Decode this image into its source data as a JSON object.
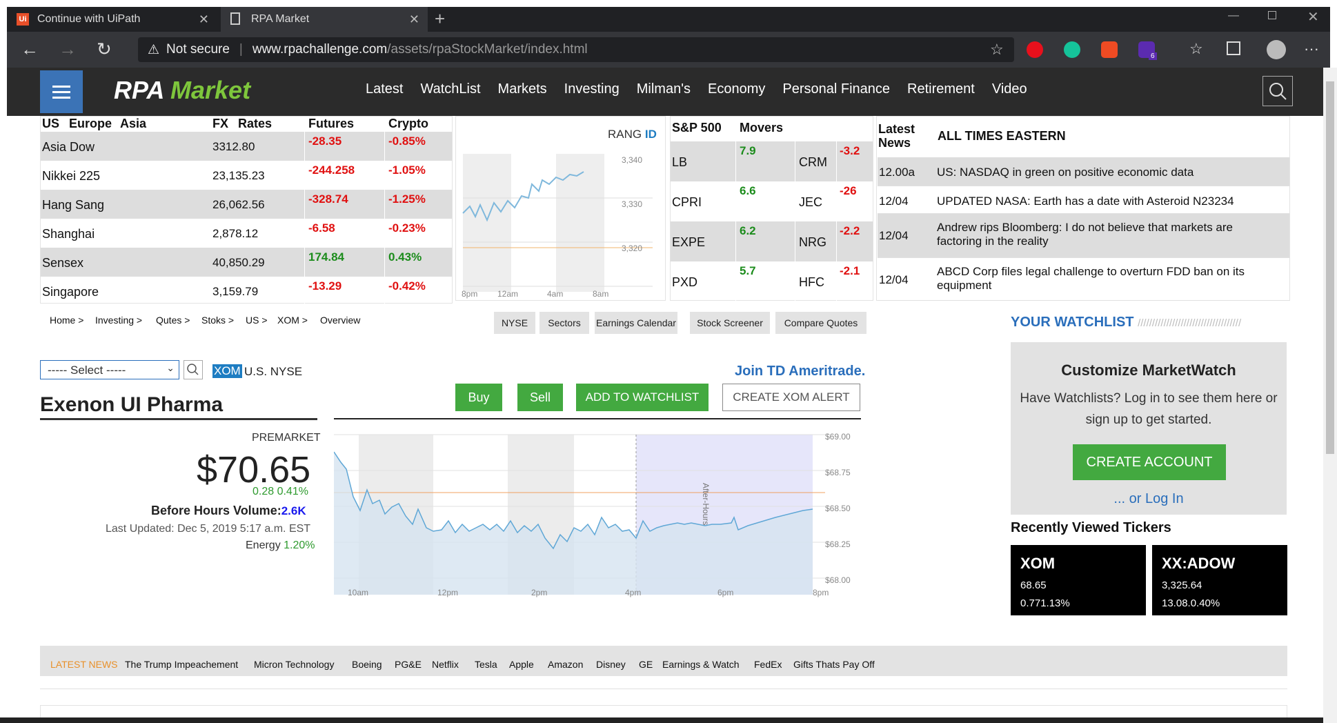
{
  "browser": {
    "tabs": [
      {
        "label": "Continue with UiPath"
      },
      {
        "label": "RPA Market"
      }
    ],
    "security": "Not secure",
    "url_host": "www.rpachallenge.com",
    "url_path": "/assets/rpaStockMarket/index.html",
    "ext_badge": "6",
    "ellipsis": "···"
  },
  "site": {
    "brand_a": "RPA",
    "brand_b": "Market",
    "nav": [
      "Latest",
      "WatchList",
      "Markets",
      "Investing",
      "Milman's",
      "Economy",
      "Personal Finance",
      "Retirement",
      "Video"
    ]
  },
  "markets": {
    "headers": [
      "US",
      "Europe",
      "Asia",
      "FX",
      "Rates",
      "Futures",
      "Crypto"
    ],
    "rows": [
      {
        "name": "Asia Dow",
        "fx": "3312.80",
        "fut": "-28.35",
        "cry": "-0.85%"
      },
      {
        "name": "Nikkei 225",
        "fx": "23,135.23",
        "fut": "-244.258",
        "cry": "-1.05%"
      },
      {
        "name": "Hang Sang",
        "fx": "26,062.56",
        "fut": "-328.74",
        "cry": "-1.25%"
      },
      {
        "name": "Shanghai",
        "fx": "2,878.12",
        "fut": "-6.58",
        "cry": "-0.23%"
      },
      {
        "name": "Sensex",
        "fx": "40,850.29",
        "fut": "174.84",
        "cry": "0.43%"
      },
      {
        "name": "Singapore",
        "fx": "3,159.79",
        "fut": "-13.29",
        "cry": "-0.42%"
      }
    ]
  },
  "mini_chart": {
    "label_a": "RANG",
    "label_b": "ID",
    "y_ticks": [
      "3,340",
      "3,330",
      "3,320"
    ],
    "x_ticks": [
      "8pm",
      "12am",
      "4am",
      "8am"
    ]
  },
  "sp500": {
    "h1": "S&P 500",
    "h2": "Movers",
    "rows": [
      {
        "l": "LB",
        "lv": "7.9",
        "r": "CRM",
        "rv": "-3.2"
      },
      {
        "l": "CPRI",
        "lv": "6.6",
        "r": "JEC",
        "rv": "-26"
      },
      {
        "l": "EXPE",
        "lv": "6.2",
        "r": "NRG",
        "rv": "-2.2"
      },
      {
        "l": "PXD",
        "lv": "5.7",
        "r": "HFC",
        "rv": "-2.1"
      }
    ]
  },
  "news": {
    "h1": "Latest News",
    "h2": "ALL TIMES EASTERN",
    "rows": [
      {
        "t": "12.00a",
        "h": "US: NASDAQ in green on positive economic data"
      },
      {
        "t": "12/04",
        "h": "UPDATED NASA: Earth has a date with Asteroid N23234"
      },
      {
        "t": "12/04",
        "h": "Andrew rips Bloomberg: I do not believe that markets are factoring in the reality"
      },
      {
        "t": "12/04",
        "h": "ABCD Corp files legal challenge to overturn FDD ban on its equipment"
      }
    ]
  },
  "breadcrumb": [
    "Home >",
    "Investing >",
    "Qutes >",
    "Stoks >",
    "US >",
    "XOM >",
    "Overview"
  ],
  "quick_links": [
    "NYSE",
    "Sectors",
    "Earnings Calendar",
    "Stock Screener",
    "Compare Quotes"
  ],
  "stock": {
    "select": "----- Select -----",
    "ticker": "XOM",
    "exchange": "U.S. NYSE",
    "name": "Exenon UI Pharma",
    "premarket": "PREMARKET",
    "price": "$70.65",
    "change": "0.28 0.41%",
    "volume_label": "Before Hours Volume:",
    "volume": "2.6K",
    "updated": "Last Updated: Dec 5, 2019 5:17 a.m. EST",
    "sector": "Energy",
    "sector_change": "1.20%",
    "join": "Join TD Ameritrade.",
    "buy": "Buy",
    "sell": "Sell",
    "watch": "ADD TO WATCHLIST",
    "alert": "CREATE XOM ALERT"
  },
  "main_chart": {
    "y_ticks": [
      "$69.00",
      "$68.75",
      "$68.50",
      "$68.25",
      "$68.00"
    ],
    "x_ticks": [
      "10am",
      "12pm",
      "2pm",
      "4pm",
      "6pm",
      "8pm"
    ],
    "after": "After-Hours"
  },
  "watchlist": {
    "title": "YOUR WATCHLIST",
    "heading": "Customize MarketWatch",
    "text": "Have Watchlists? Log in to see them here or sign up to get started.",
    "create": "CREATE ACCOUNT",
    "login": "... or Log In",
    "recent": "Recently Viewed Tickers",
    "cards": [
      {
        "sym": "XOM",
        "p": "68.65",
        "c": "0.771.13%"
      },
      {
        "sym": "XX:ADOW",
        "p": "3,325.64",
        "c": "13.08.0.40%"
      }
    ]
  },
  "latest_bar": {
    "label": "LATEST NEWS",
    "items": [
      "The Trump Impeachement",
      "Micron Technology",
      "Boeing",
      "PG&E",
      "Netflix",
      "Tesla",
      "Apple",
      "Amazon",
      "Disney",
      "GE",
      "Earnings & Watch",
      "FedEx",
      "Gifts Thats Pay Off"
    ]
  }
}
